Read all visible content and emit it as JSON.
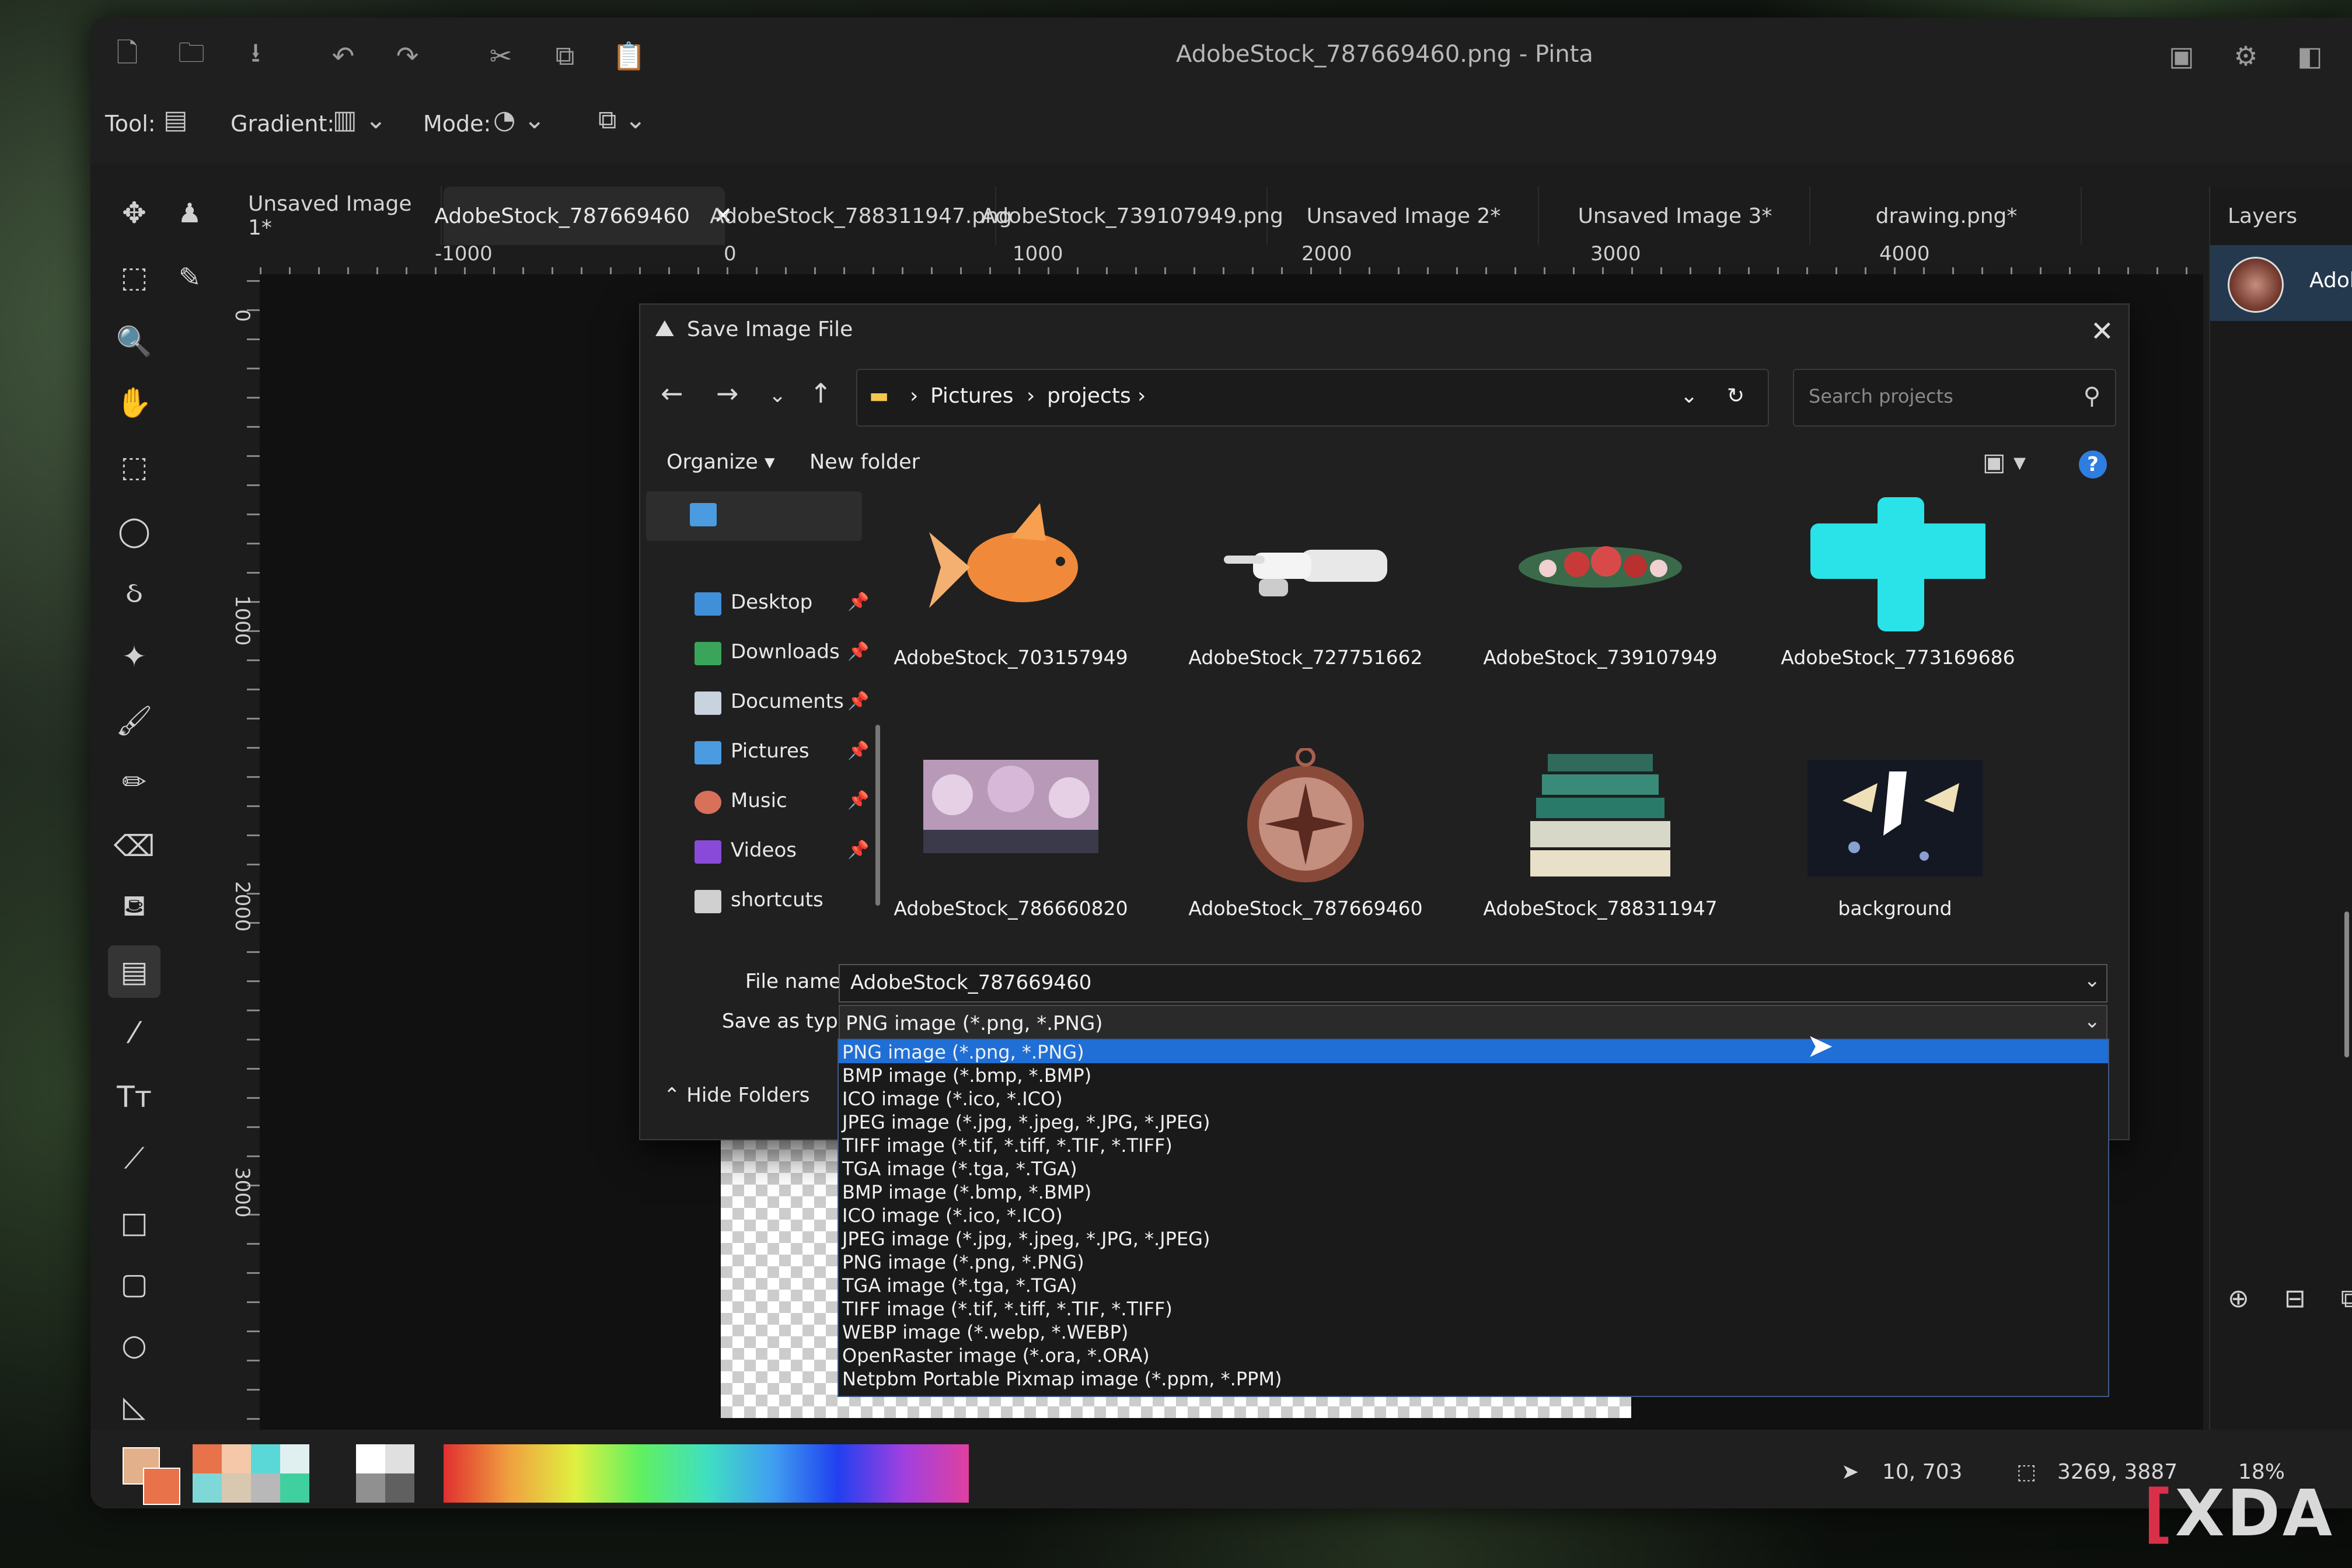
{
  "window": {
    "title": "AdobeStock_787669460.png - Pinta"
  },
  "toolbar": {
    "tool_label": "Tool:",
    "gradient_label": "Gradient:",
    "mode_label": "Mode:"
  },
  "tabs": [
    {
      "label": "Unsaved Image 1*"
    },
    {
      "label": "AdobeStock_787669460",
      "close": "✕"
    },
    {
      "label": "AdobeStock_788311947.png"
    },
    {
      "label": "AdobeStock_739107949.png"
    },
    {
      "label": "Unsaved Image 2*"
    },
    {
      "label": "Unsaved Image 3*"
    },
    {
      "label": "drawing.png*"
    }
  ],
  "ruler": {
    "h_labels": [
      "-1000",
      "0",
      "1000",
      "2000",
      "3000",
      "4000"
    ],
    "v_labels": [
      "0",
      "1000",
      "2000",
      "3000"
    ]
  },
  "layers": {
    "title": "Layers",
    "items": [
      {
        "name": "AdobeStock"
      }
    ]
  },
  "dialog": {
    "title": "Save Image File",
    "path": [
      "Pictures",
      "projects"
    ],
    "search_placeholder": "Search projects",
    "organize": "Organize",
    "new_folder": "New folder",
    "help": "?",
    "nav": [
      {
        "label": "Desktop",
        "color": "#3f8fd9"
      },
      {
        "label": "Downloads",
        "color": "#3aa55a"
      },
      {
        "label": "Documents",
        "color": "#c9d3e0"
      },
      {
        "label": "Pictures",
        "color": "#4a9be0"
      },
      {
        "label": "Music",
        "color": "#d9705a"
      },
      {
        "label": "Videos",
        "color": "#8a4ad9"
      },
      {
        "label": "shortcuts",
        "color": "#d0d0d0"
      }
    ],
    "files": [
      {
        "name": "AdobeStock_703157949"
      },
      {
        "name": "AdobeStock_727751662"
      },
      {
        "name": "AdobeStock_739107949"
      },
      {
        "name": "AdobeStock_773169686"
      },
      {
        "name": "AdobeStock_786660820"
      },
      {
        "name": "AdobeStock_787669460"
      },
      {
        "name": "AdobeStock_788311947"
      },
      {
        "name": "background"
      }
    ],
    "file_name_label": "File name:",
    "file_name_value": "AdobeStock_787669460",
    "save_type_label": "Save as type:",
    "save_type_value": "PNG image (*.png, *.PNG)",
    "hide_folders": "Hide Folders"
  },
  "type_options": [
    "PNG image (*.png, *.PNG)",
    "BMP image (*.bmp, *.BMP)",
    "ICO image (*.ico, *.ICO)",
    "JPEG image (*.jpg, *.jpeg, *.JPG, *.JPEG)",
    "TIFF image (*.tif, *.tiff, *.TIF, *.TIFF)",
    "TGA image (*.tga, *.TGA)",
    "BMP image (*.bmp, *.BMP)",
    "ICO image (*.ico, *.ICO)",
    "JPEG image (*.jpg, *.jpeg, *.JPG, *.JPEG)",
    "PNG image (*.png, *.PNG)",
    "TGA image (*.tga, *.TGA)",
    "TIFF image (*.tif, *.tiff, *.TIF, *.TIFF)",
    "WEBP image (*.webp, *.WEBP)",
    "OpenRaster image (*.ora, *.ORA)",
    "Netpbm Portable Pixmap image (*.ppm, *.PPM)"
  ],
  "status": {
    "cursor_pos": "10, 703",
    "selection_size": "3269, 3887",
    "zoom": "18%"
  },
  "watermark": "XDA",
  "colors": {
    "accent": "#1f6fd6",
    "primary_color": "#e2b08a",
    "secondary_color": "#e8734a"
  }
}
